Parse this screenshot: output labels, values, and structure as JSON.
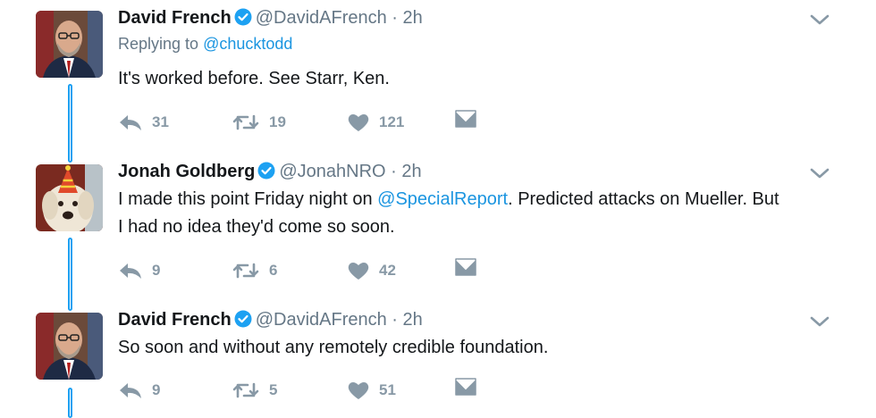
{
  "tweets": [
    {
      "name": "David French",
      "handle": "@DavidAFrench",
      "time": "· 2h",
      "replying_label": "Replying to ",
      "replying_to": "@chucktodd",
      "text": "It's worked before. See Starr, Ken.",
      "replies": "31",
      "retweets": "19",
      "likes": "121"
    },
    {
      "name": "Jonah Goldberg",
      "handle": "@JonahNRO",
      "time": "· 2h",
      "text_before": "I made this point Friday night on ",
      "text_mention": "@SpecialReport",
      "text_after": ". Predicted attacks on Mueller. But I had no idea they'd come so soon.",
      "replies": "9",
      "retweets": "6",
      "likes": "42"
    },
    {
      "name": "David French",
      "handle": "@DavidAFrench",
      "time": "· 2h",
      "text": "So soon and without any remotely credible foundation.",
      "replies": "9",
      "retweets": "5",
      "likes": "51"
    }
  ],
  "colors": {
    "link": "#1b95e0",
    "thread_line": "#1da1f2",
    "muted": "#657786",
    "icon": "#8899a6"
  },
  "icons": [
    "verified-badge-icon",
    "chevron-down-icon",
    "reply-icon",
    "retweet-icon",
    "heart-icon",
    "direct-message-icon"
  ]
}
